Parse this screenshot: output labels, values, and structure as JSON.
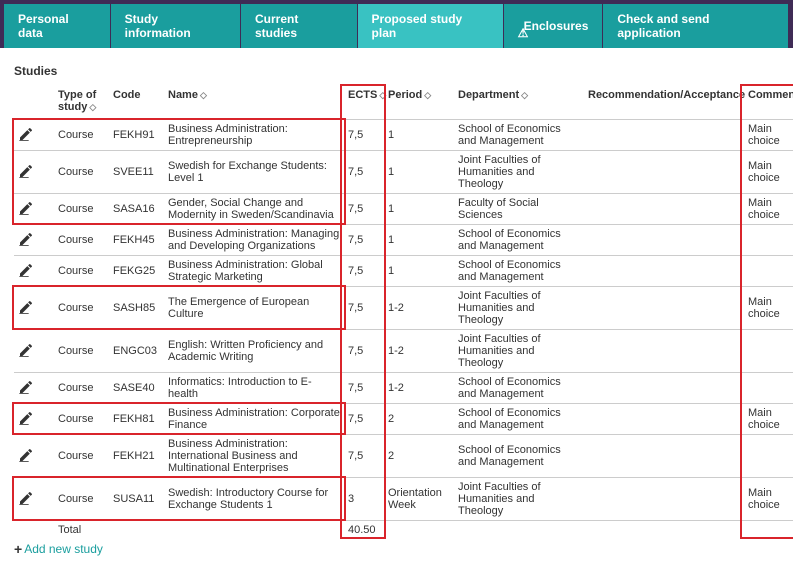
{
  "tabs": [
    {
      "label": "Personal data"
    },
    {
      "label": "Study information"
    },
    {
      "label": "Current studies"
    },
    {
      "label": "Proposed study plan",
      "active": true
    },
    {
      "label": "Enclosures",
      "warn": true
    },
    {
      "label": "Check and send application"
    }
  ],
  "heading": "Studies",
  "columns": {
    "type": "Type of study",
    "code": "Code",
    "name": "Name",
    "ects": "ECTS",
    "period": "Period",
    "dept": "Department",
    "rec": "Recommendation/Acceptance",
    "comm": "Comment"
  },
  "rows": [
    {
      "type": "Course",
      "code": "FEKH91",
      "name": "Business Administration: Entrepreneurship",
      "ects": "7,5",
      "period": "1",
      "dept": "School of Economics and Management",
      "comm": "Main choice"
    },
    {
      "type": "Course",
      "code": "SVEE11",
      "name": "Swedish for Exchange Students: Level 1",
      "ects": "7,5",
      "period": "1",
      "dept": "Joint Faculties of Humanities and Theology",
      "comm": "Main choice"
    },
    {
      "type": "Course",
      "code": "SASA16",
      "name": "Gender, Social Change and Modernity in Sweden/Scandinavia",
      "ects": "7,5",
      "period": "1",
      "dept": "Faculty of Social Sciences",
      "comm": "Main choice"
    },
    {
      "type": "Course",
      "code": "FEKH45",
      "name": "Business Administration: Managing and Developing Organizations",
      "ects": "7,5",
      "period": "1",
      "dept": "School of Economics and Management",
      "comm": ""
    },
    {
      "type": "Course",
      "code": "FEKG25",
      "name": "Business Administration: Global Strategic Marketing",
      "ects": "7,5",
      "period": "1",
      "dept": "School of Economics and Management",
      "comm": ""
    },
    {
      "type": "Course",
      "code": "SASH85",
      "name": "The Emergence of European Culture",
      "ects": "7,5",
      "period": "1-2",
      "dept": "Joint Faculties of Humanities and Theology",
      "comm": "Main choice"
    },
    {
      "type": "Course",
      "code": "ENGC03",
      "name": "English: Written Proficiency and Academic Writing",
      "ects": "7,5",
      "period": "1-2",
      "dept": "Joint Faculties of Humanities and Theology",
      "comm": ""
    },
    {
      "type": "Course",
      "code": "SASE40",
      "name": "Informatics: Introduction to E-health",
      "ects": "7,5",
      "period": "1-2",
      "dept": "School of Economics and Management",
      "comm": ""
    },
    {
      "type": "Course",
      "code": "FEKH81",
      "name": "Business Administration: Corporate Finance",
      "ects": "7,5",
      "period": "2",
      "dept": "School of Economics and Management",
      "comm": "Main choice"
    },
    {
      "type": "Course",
      "code": "FEKH21",
      "name": "Business Administration: International Business and Multinational Enterprises",
      "ects": "7,5",
      "period": "2",
      "dept": "School of Economics and Management",
      "comm": ""
    },
    {
      "type": "Course",
      "code": "SUSA11",
      "name": "Swedish: Introductory Course for Exchange Students 1",
      "ects": "3",
      "period": "Orientation Week",
      "dept": "Joint Faculties of Humanities and Theology",
      "comm": "Main choice"
    }
  ],
  "total": {
    "label": "Total",
    "ects": "40.50"
  },
  "addnew": "Add new study"
}
